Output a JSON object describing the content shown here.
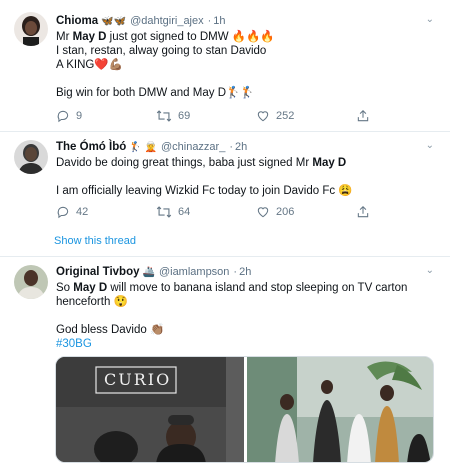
{
  "tweets": [
    {
      "name": "Chioma",
      "decorations": "🦋🦋",
      "handle": "@dahtgiri_ajex",
      "dot": "·",
      "time": "1h",
      "lines": [
        {
          "pre": "Mr ",
          "bold": "May D",
          "post": " just got signed to DMW 🔥🔥🔥"
        },
        {
          "pre": "I stan, restan, alway going to stan Davido",
          "bold": "",
          "post": ""
        },
        {
          "pre": "A KING❤️💪🏽",
          "bold": "",
          "post": ""
        },
        {
          "pre": "",
          "bold": "",
          "post": ""
        },
        {
          "pre": "Big win for both DMW and May D🏌️🏌️",
          "bold": "",
          "post": ""
        }
      ],
      "replies": "9",
      "retweets": "69",
      "likes": "252"
    },
    {
      "name": "The Ómó Ìbó",
      "decorations": "🏌️ 🧝",
      "handle": "@chinazzar_",
      "dot": "·",
      "time": "2h",
      "lines": [
        {
          "pre": "Davido be doing great things, baba just signed Mr ",
          "bold": "May D",
          "post": ""
        },
        {
          "pre": "",
          "bold": "",
          "post": ""
        },
        {
          "pre": "I am officially leaving Wizkid Fc today to join Davido Fc  😩",
          "bold": "",
          "post": ""
        }
      ],
      "replies": "42",
      "retweets": "64",
      "likes": "206"
    },
    {
      "name": "Original Tivboy",
      "decorations": "🚢",
      "handle": "@iamlampson",
      "dot": "·",
      "time": "2h",
      "lines": [
        {
          "pre": "So ",
          "bold": "May D",
          "post": " will move to banana island and stop sleeping on TV carton"
        },
        {
          "pre": "henceforth 😲",
          "bold": "",
          "post": ""
        },
        {
          "pre": "",
          "bold": "",
          "post": ""
        },
        {
          "pre": "God bless Davido 👏🏽",
          "bold": "",
          "post": ""
        }
      ],
      "hashtag": "#30BG"
    }
  ],
  "show_thread": "Show this thread",
  "media": {
    "sign_text": "CURIO"
  }
}
